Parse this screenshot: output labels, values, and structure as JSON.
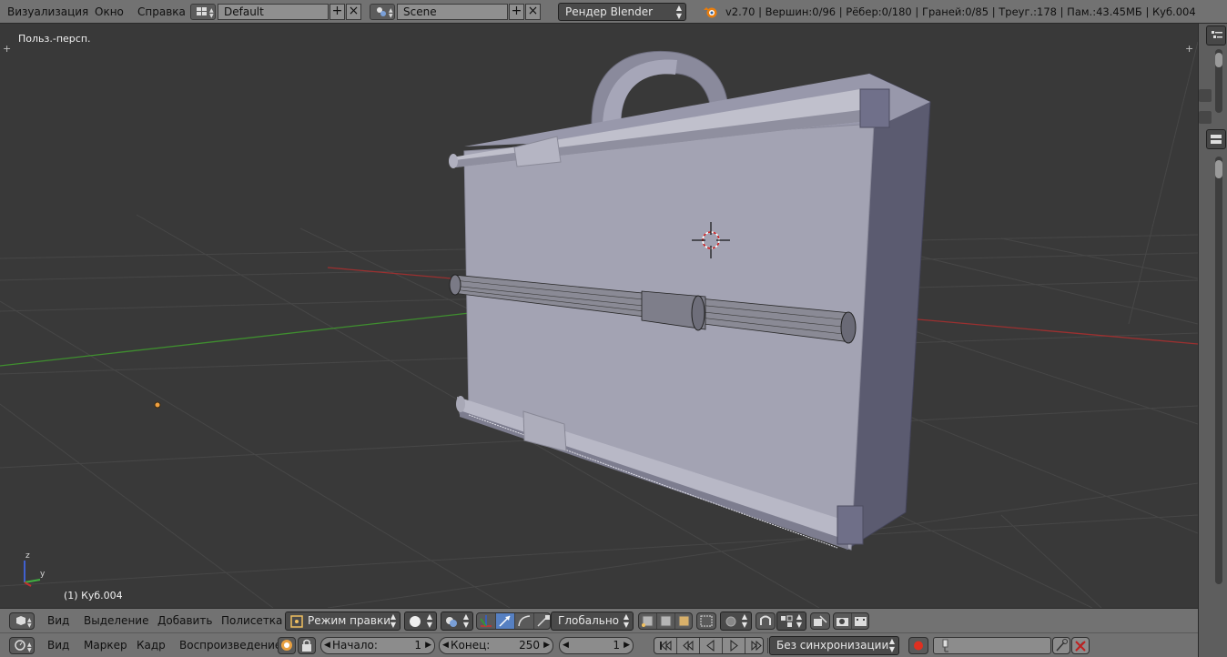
{
  "topbar": {
    "menus": [
      "Визуализация",
      "Окно",
      "Справка"
    ],
    "screen_layout": "Default",
    "scene": "Scene",
    "render_engine": "Рендер Blender",
    "stats": "v2.70 | Вершин:0/96 | Рёбер:0/180 | Граней:0/85 | Треуг.:178 | Пам.:43.45МБ | Куб.004"
  },
  "viewport": {
    "view_name": "Польз.-персп.",
    "object_label": "(1) Куб.004",
    "axis_y": "y",
    "axis_z": "z"
  },
  "view_header": {
    "menus": [
      "Вид",
      "Выделение",
      "Добавить",
      "Полисетка"
    ],
    "mode": "Режим правки",
    "orientation": "Глобально"
  },
  "timeline_header": {
    "menus": [
      "Вид",
      "Маркер",
      "Кадр",
      "Воспроизведение"
    ],
    "start_label": "Начало:",
    "start_value": "1",
    "end_label": "Конец:",
    "end_value": "250",
    "current_frame": "1",
    "sync": "Без синхронизации"
  },
  "colors": {
    "header_bg": "#727272",
    "viewport_bg": "#393939",
    "grid_line": "#474747",
    "x_axis": "#9b3030",
    "y_axis": "#3f8f2f",
    "mesh_face": "#a3a3b3",
    "accent_blue": "#5680c2"
  }
}
